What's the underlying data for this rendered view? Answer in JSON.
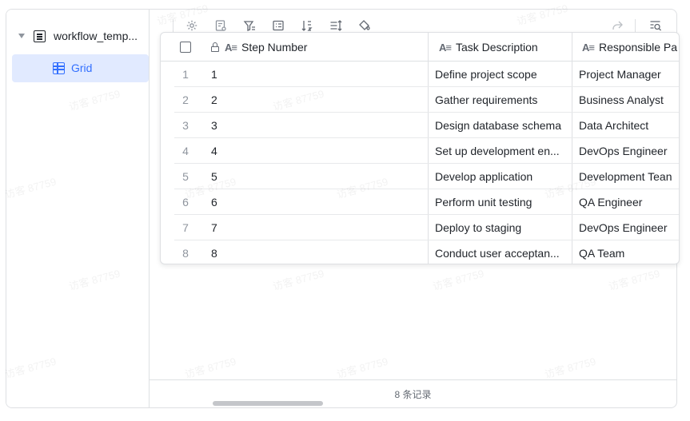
{
  "sidebar": {
    "table_name": "workflow_temp...",
    "views": [
      {
        "label": "Grid",
        "selected": true
      }
    ]
  },
  "toolbar": {
    "left_icons": [
      "settings-icon",
      "form-icon",
      "filter-icon",
      "group-icon",
      "sort-icon",
      "row-height-icon",
      "fill-color-icon"
    ],
    "right_icons": [
      "share-icon",
      "search-icon"
    ]
  },
  "table": {
    "columns": [
      {
        "label": "Step Number",
        "type": "text",
        "locked": true
      },
      {
        "label": "Task Description",
        "type": "text"
      },
      {
        "label": "Responsible Pa",
        "type": "text"
      }
    ],
    "rows": [
      {
        "num": "1",
        "step": "1",
        "task": "Define project scope",
        "owner": "Project Manager"
      },
      {
        "num": "2",
        "step": "2",
        "task": "Gather requirements",
        "owner": "Business Analyst"
      },
      {
        "num": "3",
        "step": "3",
        "task": "Design database schema",
        "owner": "Data Architect"
      },
      {
        "num": "4",
        "step": "4",
        "task": "Set up development en...",
        "owner": "DevOps Engineer"
      },
      {
        "num": "5",
        "step": "5",
        "task": "Develop application",
        "owner": "Development Tean"
      },
      {
        "num": "6",
        "step": "6",
        "task": "Perform unit testing",
        "owner": "QA Engineer"
      },
      {
        "num": "7",
        "step": "7",
        "task": "Deploy to staging",
        "owner": "DevOps Engineer"
      },
      {
        "num": "8",
        "step": "8",
        "task": "Conduct user acceptan...",
        "owner": "QA Team"
      }
    ]
  },
  "footer": {
    "record_count": "8 条记录"
  },
  "watermark": "访客 87759",
  "colors": {
    "accent": "#3370ff",
    "selected_bg": "#e1eaff",
    "border": "#dee0e3"
  }
}
